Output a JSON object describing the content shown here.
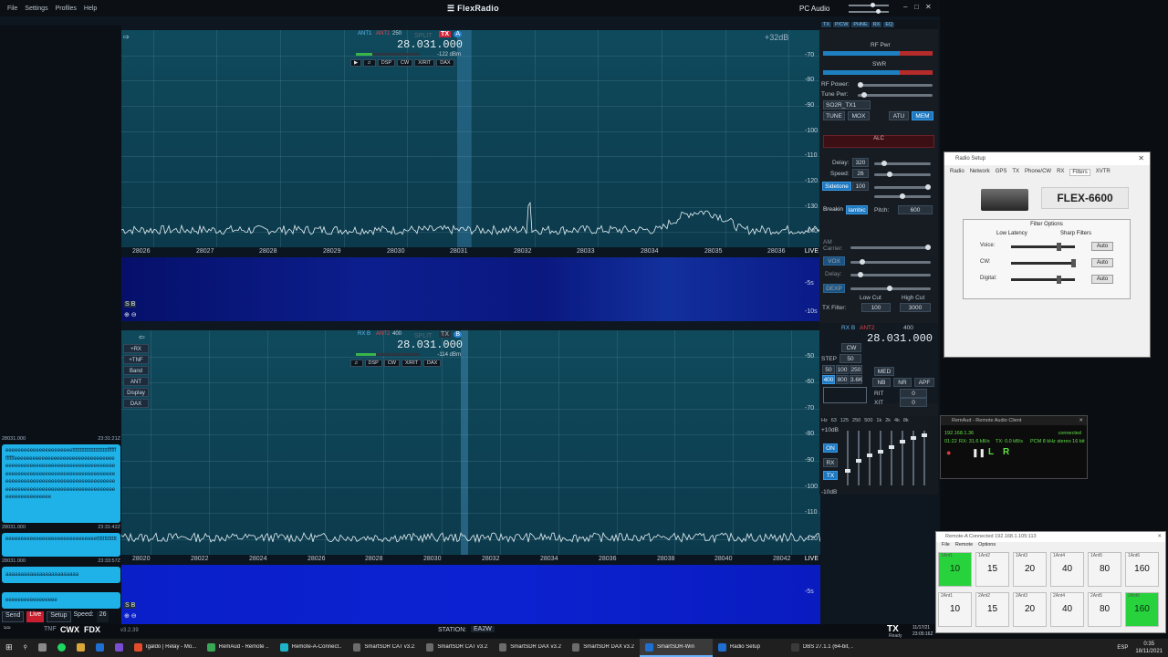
{
  "app": {
    "brand": "FlexRadio",
    "menu": [
      "File",
      "Settings",
      "Profiles",
      "Help"
    ],
    "pc_audio": "PC Audio",
    "version": "v3.2.39"
  },
  "chat": [
    {
      "time_left": "28031.000",
      "time_right": "23:31:21Z",
      "text": "eeeeeeeeeeeeeeeeeeeeeetttttttttttttttttttttttffffffffffffeeeeeeeeeeeeeeeeeeeeeeeeeeeeeeeeeeeeeeeeeeeeeeeeeeeeeeeeeeeeeeeeeeeeeeeeeeeeeeeeeeeeeeeeeeeeeeeeeeeeeeeeeeeeeeeeeeeeeeeeeeeeeeeeeeeeeeeeeeeeeeeeeeeeeeeeeeeeeeeeeeeeeeeeeeeeeeeeeeeeeeeeeeeeeeee"
    },
    {
      "time_left": "28031.000",
      "time_right": "23:31:42Z",
      "text": "eeeeeeeeeeeeeeeeeeeeeeeeeeeeeettttttttttttt"
    },
    {
      "time_left": "28031.000",
      "time_right": "23:33:57Z",
      "text": "aaaaaaaaaaaaaaaaaaaaaaaa"
    },
    {
      "time_left": "",
      "time_right": "",
      "text": "eeeeeeeeeeeeeeeee"
    }
  ],
  "chat_controls": {
    "send": "Send",
    "live": "Live",
    "setup": "Setup",
    "speed_label": "Speed:",
    "speed": "26"
  },
  "panadapter_a": {
    "db_label": "+32dB",
    "db_ticks": [
      "-70",
      "-80",
      "-90",
      "-100",
      "-110",
      "-120",
      "-130",
      "-140"
    ],
    "freq_ticks": [
      "28026",
      "28027",
      "28028",
      "28029",
      "28030",
      "28031",
      "28032",
      "28033",
      "28034",
      "28035",
      "28036"
    ],
    "live": "LIVE",
    "wf_ticks": [
      "-5s",
      "-10s"
    ],
    "slice": {
      "ant_rx": "ANT1",
      "ant_tx": "ANT1",
      "filter": "250",
      "mode": "CW",
      "split": "SPLIT",
      "tx": "TX",
      "letter": "A",
      "freq": "28.031.000",
      "dbm": "-122 dBm",
      "buttons": [
        "DSP",
        "CW",
        "X/RIT",
        "DAX"
      ]
    }
  },
  "panadapter_b": {
    "db_ticks": [
      "-50",
      "-60",
      "-70",
      "-80",
      "-90",
      "-100",
      "-110",
      "-120"
    ],
    "freq_ticks": [
      "28020",
      "28022",
      "28024",
      "28026",
      "28028",
      "28030",
      "28032",
      "28034",
      "28036",
      "28038",
      "28040",
      "28042"
    ],
    "live": "LIVE",
    "wf_ticks": [
      "-5s"
    ],
    "side_buttons": [
      "+RX",
      "+TNF",
      "Band",
      "ANT",
      "Display",
      "DAX"
    ],
    "slice": {
      "ant_rx": "RX B",
      "ant_tx": "ANT2",
      "filter": "400",
      "split": "SPLIT",
      "tx": "TX",
      "letter": "B",
      "freq": "28.031.000",
      "dbm": "-114 dBm",
      "buttons": [
        "DSP",
        "CW",
        "X/RIT",
        "DAX"
      ]
    }
  },
  "tx_panel": {
    "tabs": [
      "TX",
      "P/CW",
      "PHNE",
      "RX",
      "EQ"
    ],
    "rf_pwr_label": "RF Pwr",
    "swr_label": "SWR",
    "rf_power": "RF Power:",
    "tune_pwr": "Tune Pwr:",
    "profile": "SO2R_TX1",
    "buttons": [
      "TUNE",
      "MOX",
      "ATU",
      "MEM"
    ],
    "alc": "ALC",
    "delay_label": "Delay:",
    "delay": "320",
    "speed_label": "Speed:",
    "speed": "26",
    "sidetone": "Sidetone",
    "sidetone_val": "100",
    "breakin": "Breakin",
    "iambic": "Iambic",
    "pitch_label": "Pitch:",
    "pitch": "600",
    "am_carrier": "AM Carrier:",
    "vox": "VOX",
    "dexp": "DEXP",
    "vox_delay": "Delay:",
    "low_cut": "Low Cut",
    "high_cut": "High Cut",
    "tx_filter": "TX Filter:",
    "low_val": "100",
    "high_val": "3000"
  },
  "rx_panel": {
    "slice": "RX B",
    "ant": "ANT2",
    "filter": "400",
    "freq": "28.031.000",
    "mode": "CW",
    "step_label": "STEP",
    "step": "50",
    "filters": [
      "50",
      "100",
      "250",
      "400",
      "800",
      "3.6K"
    ],
    "med": "MED",
    "buttons": [
      "NB",
      "NR",
      "APF"
    ],
    "rit": "RIT",
    "xit": "XIT",
    "rit_val": "0",
    "xit_val": "0"
  },
  "eq_panel": {
    "header": [
      "Hz",
      "63",
      "125",
      "250",
      "500",
      "1k",
      "2k",
      "4k",
      "8k"
    ],
    "db_top": "+10dB",
    "db_bottom": "-10dB",
    "on": "ON",
    "rx": "RX",
    "tx": "TX"
  },
  "radio_setup": {
    "title": "Radio Setup",
    "tabs": [
      "Radio",
      "Network",
      "GPS",
      "TX",
      "Phone/CW",
      "RX",
      "Filters",
      "XVTR"
    ],
    "active_tab": "Filters",
    "model": "FLEX-6600",
    "group": "Filter Options",
    "low_latency": "Low Latency",
    "sharp": "Sharp Filters",
    "rows": [
      {
        "label": "Voice:",
        "level": 0.75
      },
      {
        "label": "CW:",
        "level": 1.0
      },
      {
        "label": "Digital:",
        "level": 0.75
      }
    ],
    "auto": "Auto"
  },
  "remaud": {
    "title": "RemAud - Remote Audio Client",
    "ip": "192.168.1.36",
    "status": "connected",
    "time": "01:22",
    "rx": "RX: 31.6 kB/s",
    "tx": "TX: 0.0 kB/s",
    "fmt": "PCM 8 kHz stereo 16 bit"
  },
  "remote_a": {
    "title": "Remote-A Connected 192.168.1.105:113",
    "menu": [
      "File",
      "Remote",
      "Options"
    ],
    "row1": [
      {
        "cap": "1Ant1",
        "val": "10",
        "on": true
      },
      {
        "cap": "1Ant2",
        "val": "15",
        "on": false
      },
      {
        "cap": "1Ant3",
        "val": "20",
        "on": false
      },
      {
        "cap": "1Ant4",
        "val": "40",
        "on": false
      },
      {
        "cap": "1Ant5",
        "val": "80",
        "on": false
      },
      {
        "cap": "1Ant6",
        "val": "160",
        "on": false
      }
    ],
    "row2": [
      {
        "cap": "2Ant1",
        "val": "10",
        "on": false
      },
      {
        "cap": "2Ant2",
        "val": "15",
        "on": false
      },
      {
        "cap": "2Ant3",
        "val": "20",
        "on": false
      },
      {
        "cap": "2Ant4",
        "val": "40",
        "on": false
      },
      {
        "cap": "2Ant5",
        "val": "80",
        "on": false
      },
      {
        "cap": "2Ant6",
        "val": "160",
        "on": true
      }
    ]
  },
  "status": {
    "modes": [
      "TNF",
      "CWX",
      "FDX"
    ],
    "station_label": "STATION:",
    "station": "EA2W",
    "tx": "TX",
    "ready": "Ready",
    "date": "11/17/21",
    "utc": "23:05:16Z"
  },
  "taskbar": {
    "items": [
      "Igaldo | Relay - Mo...",
      "RemAud - Remote ...",
      "Remote-A-Connect...",
      "SmartSDR CAT v3.2...",
      "SmartSDR CAT v3.2...",
      "SmartSDR DAX v3.2...",
      "SmartSDR DAX v3.2...",
      "SmartSDR-Win",
      "Radio Setup",
      "OBS 27.1.1 (64-bit, ..."
    ],
    "lang": "ESP",
    "time": "0:35",
    "date": "18/11/2021"
  },
  "colors": {
    "accent": "#1fb2e8",
    "tx_red": "#d0243a",
    "ant_on": "#28d23c"
  }
}
